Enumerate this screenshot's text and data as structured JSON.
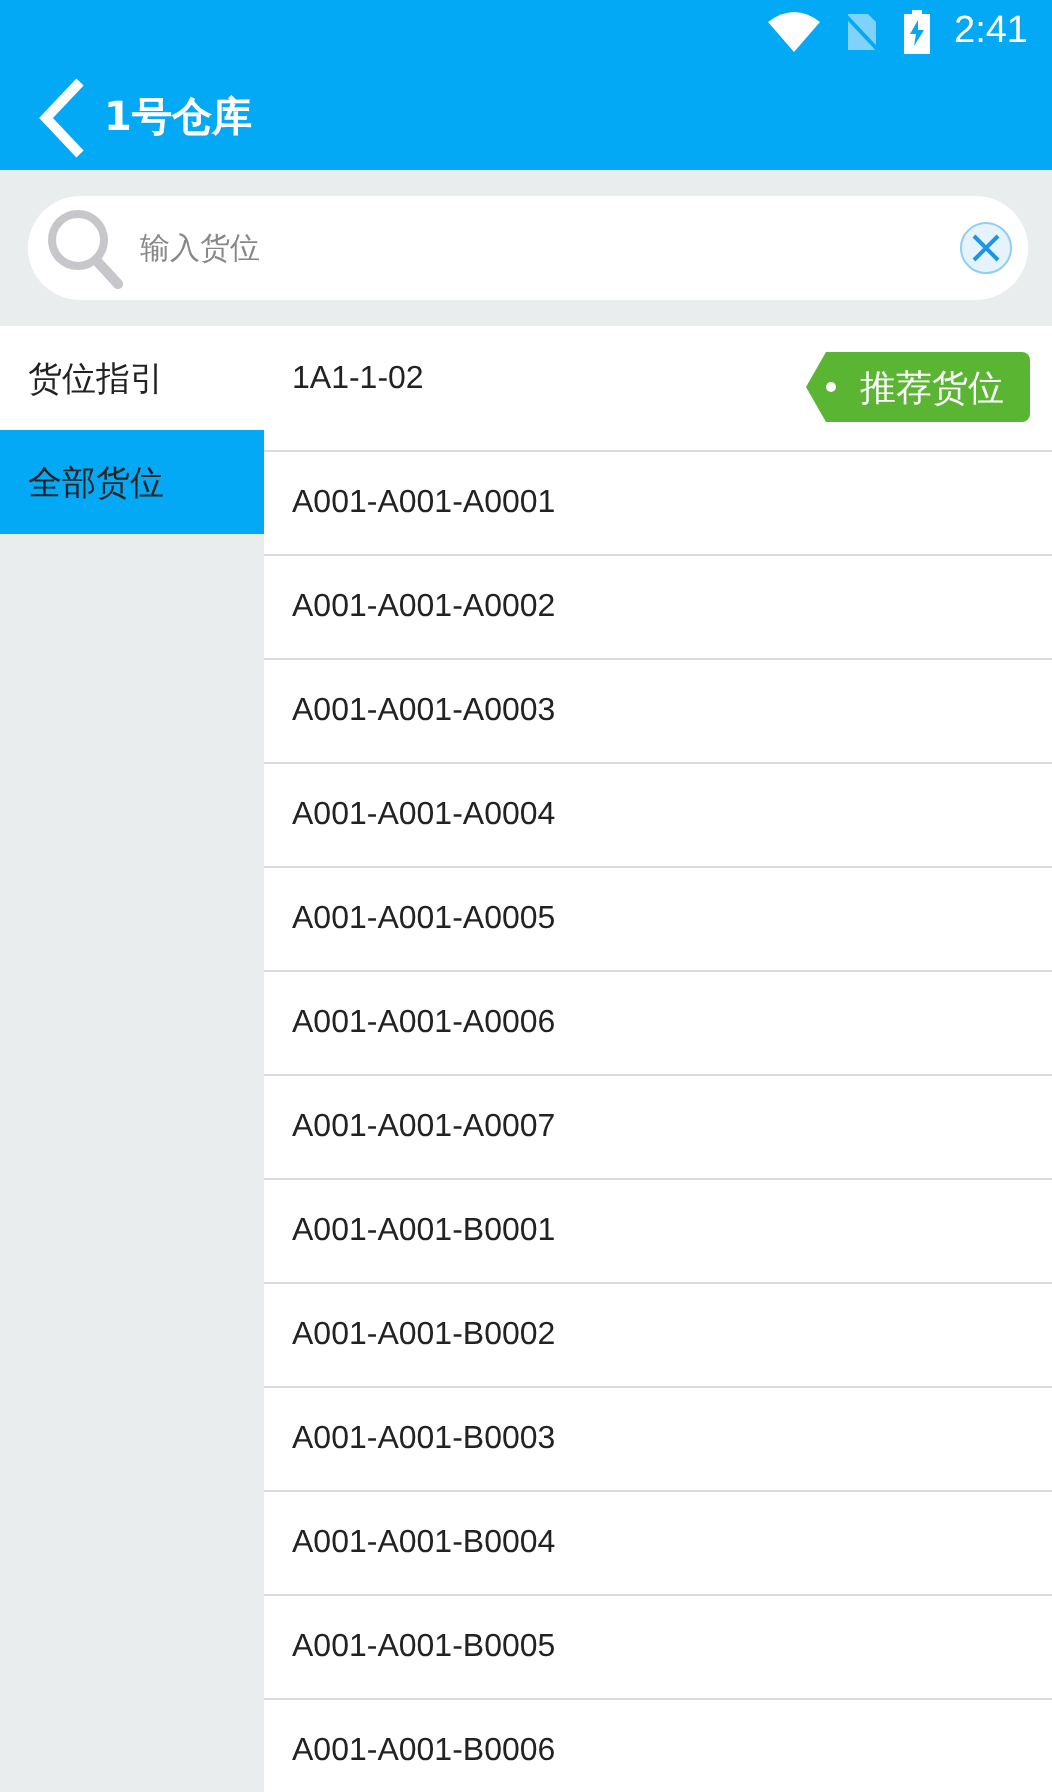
{
  "status_bar": {
    "time": "2:41"
  },
  "app_bar": {
    "title": "1号仓库"
  },
  "search": {
    "placeholder": "输入货位"
  },
  "sidebar": {
    "items": [
      {
        "label": "货位指引",
        "selected": false
      },
      {
        "label": "全部货位",
        "selected": true
      }
    ]
  },
  "locations": [
    {
      "kind": "recommended",
      "code": "1A1-1-02",
      "tag": "推荐货位"
    },
    {
      "kind": "plain",
      "code": "A001-A001-A0001"
    },
    {
      "kind": "plain",
      "code": "A001-A001-A0002"
    },
    {
      "kind": "plain",
      "code": "A001-A001-A0003"
    },
    {
      "kind": "plain",
      "code": "A001-A001-A0004"
    },
    {
      "kind": "plain",
      "code": "A001-A001-A0005"
    },
    {
      "kind": "plain",
      "code": "A001-A001-A0006"
    },
    {
      "kind": "plain",
      "code": "A001-A001-A0007"
    },
    {
      "kind": "plain",
      "code": "A001-A001-B0001"
    },
    {
      "kind": "plain",
      "code": "A001-A001-B0002"
    },
    {
      "kind": "plain",
      "code": "A001-A001-B0003"
    },
    {
      "kind": "plain",
      "code": "A001-A001-B0004"
    },
    {
      "kind": "plain",
      "code": "A001-A001-B0005"
    },
    {
      "kind": "plain",
      "code": "A001-A001-B0006"
    }
  ]
}
